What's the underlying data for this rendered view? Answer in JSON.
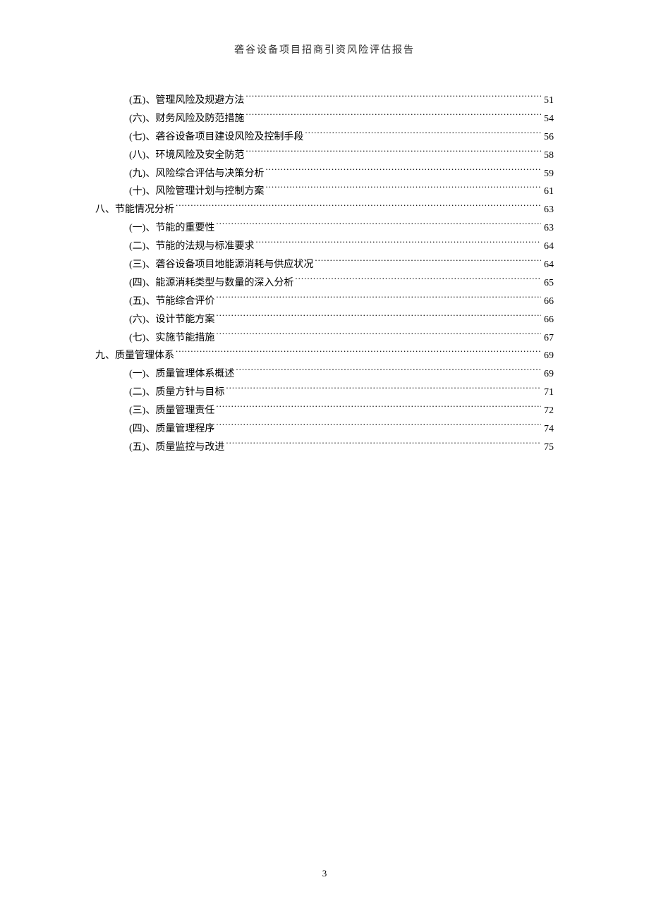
{
  "header": {
    "title": "砻谷设备项目招商引资风险评估报告"
  },
  "toc": [
    {
      "level": 2,
      "label": "(五)、管理风险及规避方法",
      "page": "51"
    },
    {
      "level": 2,
      "label": "(六)、财务风险及防范措施",
      "page": "54"
    },
    {
      "level": 2,
      "label": "(七)、砻谷设备项目建设风险及控制手段",
      "page": "56"
    },
    {
      "level": 2,
      "label": "(八)、环境风险及安全防范",
      "page": "58"
    },
    {
      "level": 2,
      "label": "(九)、风险综合评估与决策分析",
      "page": "59"
    },
    {
      "level": 2,
      "label": "(十)、风险管理计划与控制方案",
      "page": "61"
    },
    {
      "level": 1,
      "label": "八、节能情况分析",
      "page": "63"
    },
    {
      "level": 2,
      "label": "(一)、节能的重要性",
      "page": "63"
    },
    {
      "level": 2,
      "label": "(二)、节能的法规与标准要求",
      "page": "64"
    },
    {
      "level": 2,
      "label": "(三)、砻谷设备项目地能源消耗与供应状况",
      "page": "64"
    },
    {
      "level": 2,
      "label": "(四)、能源消耗类型与数量的深入分析",
      "page": "65"
    },
    {
      "level": 2,
      "label": "(五)、节能综合评价",
      "page": "66"
    },
    {
      "level": 2,
      "label": "(六)、设计节能方案",
      "page": "66"
    },
    {
      "level": 2,
      "label": "(七)、实施节能措施",
      "page": "67"
    },
    {
      "level": 1,
      "label": "九、质量管理体系",
      "page": "69"
    },
    {
      "level": 2,
      "label": "(一)、质量管理体系概述",
      "page": "69"
    },
    {
      "level": 2,
      "label": "(二)、质量方针与目标",
      "page": "71"
    },
    {
      "level": 2,
      "label": "(三)、质量管理责任",
      "page": "72"
    },
    {
      "level": 2,
      "label": "(四)、质量管理程序",
      "page": "74"
    },
    {
      "level": 2,
      "label": "(五)、质量监控与改进",
      "page": "75"
    }
  ],
  "footer": {
    "page_number": "3"
  }
}
